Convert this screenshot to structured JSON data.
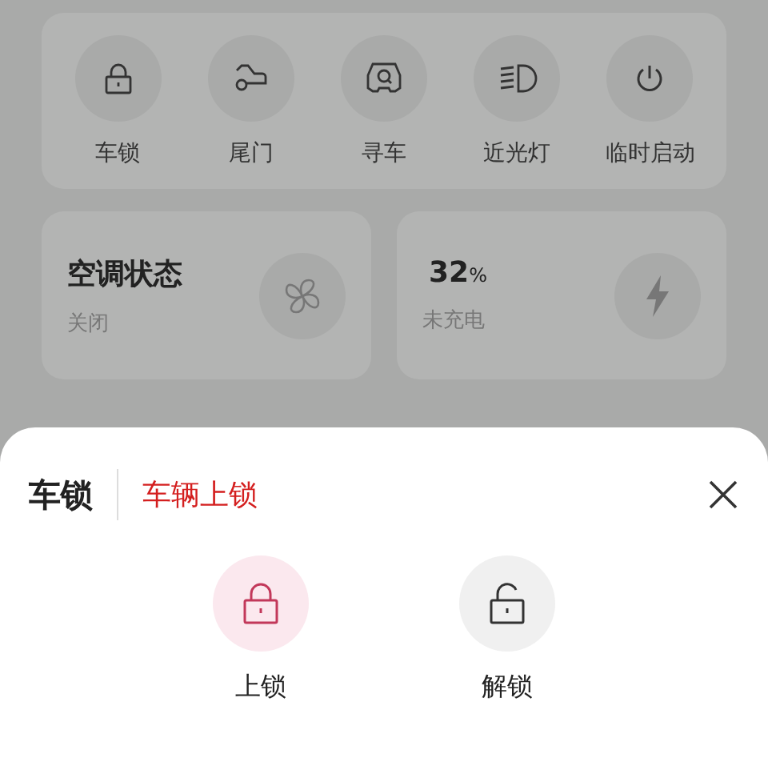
{
  "controls": [
    {
      "label": "车锁",
      "kind": "lock"
    },
    {
      "label": "尾门",
      "kind": "trunk"
    },
    {
      "label": "寻车",
      "kind": "find_car"
    },
    {
      "label": "近光灯",
      "kind": "headlight"
    },
    {
      "label": "临时启动",
      "kind": "power"
    }
  ],
  "status_cards": [
    {
      "kind": "ac",
      "title": "空调状态",
      "subtitle": "关闭"
    },
    {
      "kind": "battery",
      "value": "32",
      "unit": "%",
      "subtitle": "未充电"
    }
  ],
  "sheet": {
    "title": "车锁",
    "status": "车辆上锁",
    "options": [
      {
        "label": "上锁",
        "kind": "lock",
        "selected": true
      },
      {
        "label": "解锁",
        "kind": "unlock",
        "selected": false
      }
    ]
  }
}
